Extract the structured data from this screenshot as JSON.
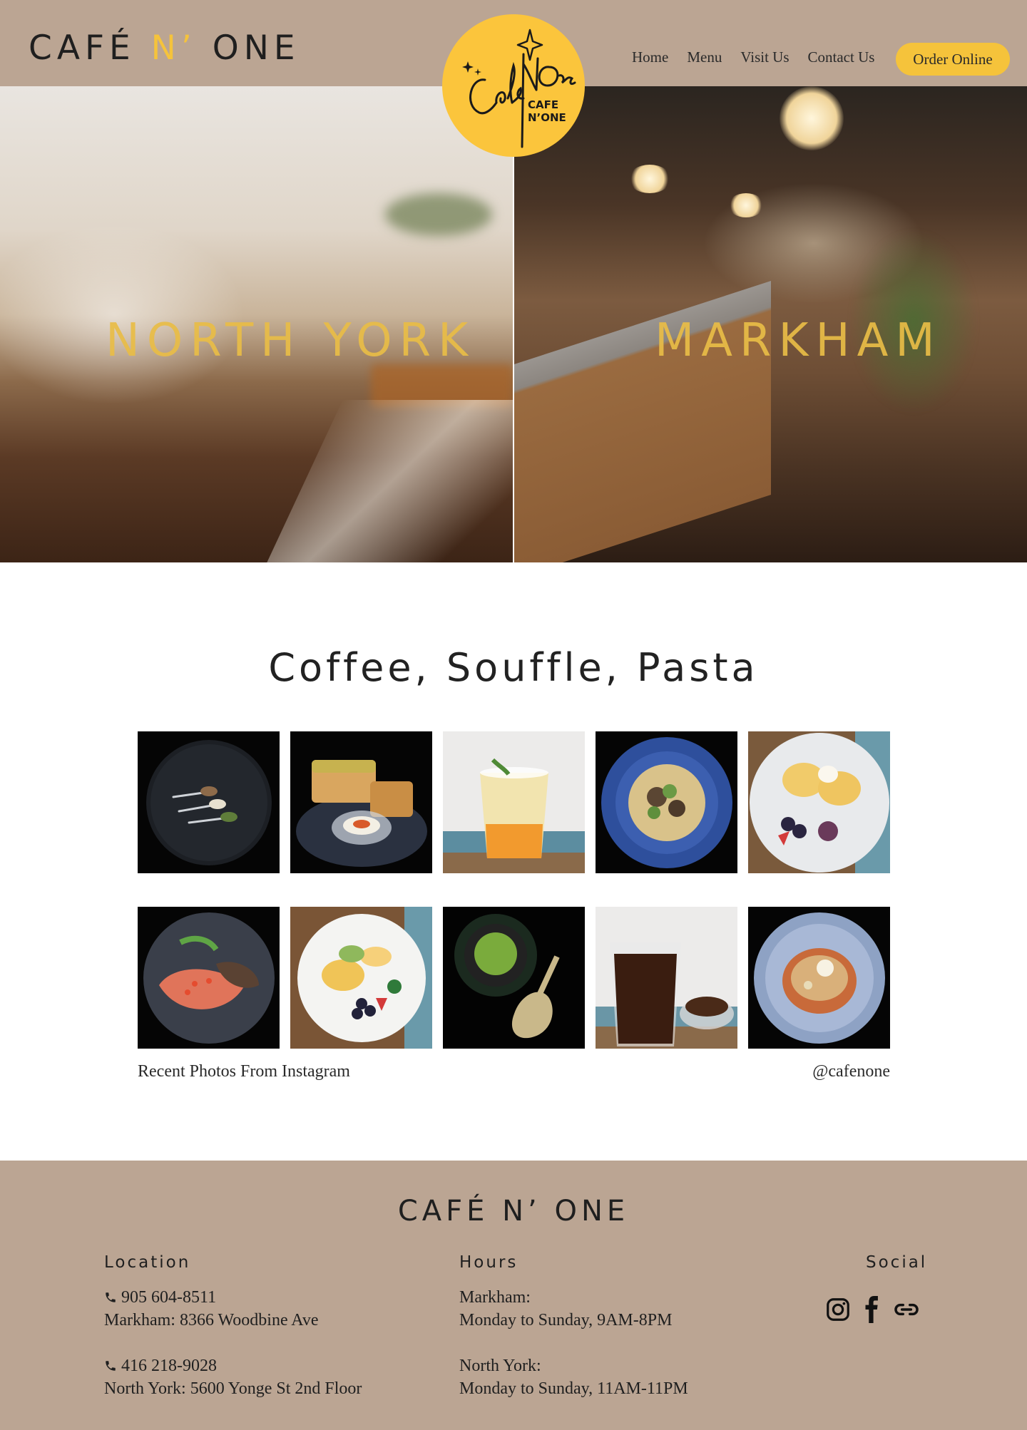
{
  "header": {
    "brand_part1": "CAFÉ",
    "brand_accent": "N’",
    "brand_part2": "ONE",
    "nav": [
      {
        "label": "Home"
      },
      {
        "label": "Menu"
      },
      {
        "label": "Visit Us"
      },
      {
        "label": "Contact Us"
      }
    ],
    "order_label": "Order Online"
  },
  "logo": {
    "script_text": "Cafe N’One",
    "line1": "CAFE",
    "line2": "N’ONE"
  },
  "hero": {
    "left_title": "NORTH YORK",
    "right_title": "MARKHAM"
  },
  "gallery": {
    "title": "Coffee, Souffle, Pasta",
    "caption_left": "Recent Photos From Instagram",
    "caption_right": "@cafenone"
  },
  "footer": {
    "brand": "CAFÉ N’ ONE",
    "location": {
      "title": "Location",
      "phone1": "905 604-8511",
      "address1": "Markham: 8366 Woodbine Ave",
      "phone2": "416 218-9028",
      "address2": "North York: 5600 Yonge St 2nd Floor"
    },
    "hours": {
      "title": "Hours",
      "loc1": "Markham:",
      "time1": "Monday to Sunday, 9AM-8PM",
      "loc2": "North York:",
      "time2": "Monday to Sunday, 11AM-11PM"
    },
    "social": {
      "title": "Social",
      "icons": [
        "instagram-icon",
        "facebook-icon",
        "link-icon"
      ]
    }
  },
  "colors": {
    "header_bg": "#bba593",
    "accent_yellow": "#f5c33b",
    "hero_text": "#e9bd47"
  }
}
